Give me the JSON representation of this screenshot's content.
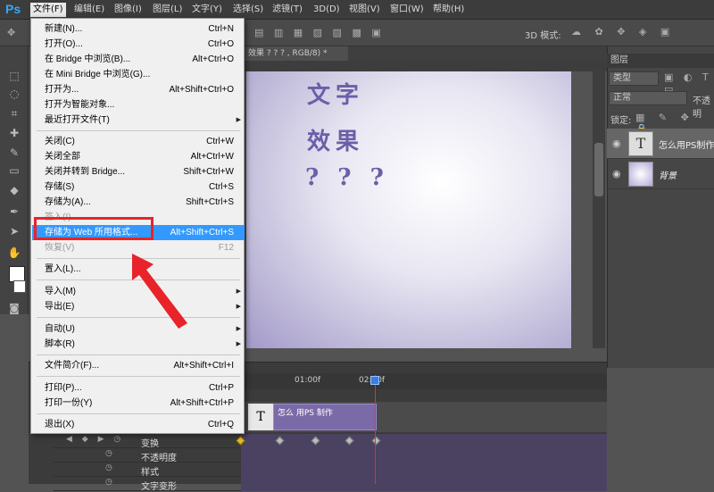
{
  "app": {
    "logo": "Ps",
    "brand_color": "#31a8ff"
  },
  "menubar": {
    "items": [
      {
        "label": "文件(F)",
        "active": true
      },
      {
        "label": "编辑(E)"
      },
      {
        "label": "图像(I)"
      },
      {
        "label": "图层(L)"
      },
      {
        "label": "文字(Y)"
      },
      {
        "label": "选择(S)"
      },
      {
        "label": "滤镜(T)"
      },
      {
        "label": "3D(D)"
      },
      {
        "label": "视图(V)"
      },
      {
        "label": "窗口(W)"
      },
      {
        "label": "帮助(H)"
      }
    ]
  },
  "options_bar": {
    "mode_label": "3D 模式:"
  },
  "document": {
    "tab_label": "效果 ? ? ? , RGB/8) *",
    "canvas_text": {
      "line1": "文字",
      "line2": "效果",
      "line3": "? ? ?"
    }
  },
  "file_menu": {
    "items": [
      {
        "label": "新建(N)...",
        "shortcut": "Ctrl+N"
      },
      {
        "label": "打开(O)...",
        "shortcut": "Ctrl+O"
      },
      {
        "label": "在 Bridge 中浏览(B)...",
        "shortcut": "Alt+Ctrl+O"
      },
      {
        "label": "在 Mini Bridge 中浏览(G)...",
        "shortcut": ""
      },
      {
        "label": "打开为...",
        "shortcut": "Alt+Shift+Ctrl+O"
      },
      {
        "label": "打开为智能对象...",
        "shortcut": ""
      },
      {
        "label": "最近打开文件(T)",
        "shortcut": "",
        "submenu": true
      },
      {
        "label": "关闭(C)",
        "shortcut": "Ctrl+W"
      },
      {
        "label": "关闭全部",
        "shortcut": "Alt+Ctrl+W"
      },
      {
        "label": "关闭并转到 Bridge...",
        "shortcut": "Shift+Ctrl+W"
      },
      {
        "label": "存储(S)",
        "shortcut": "Ctrl+S"
      },
      {
        "label": "存储为(A)...",
        "shortcut": "Shift+Ctrl+S"
      },
      {
        "label": "签入(I)...",
        "shortcut": "",
        "disabled": true
      },
      {
        "label": "存储为 Web 所用格式...",
        "shortcut": "Alt+Shift+Ctrl+S",
        "highlight": true
      },
      {
        "label": "恢复(V)",
        "shortcut": "F12",
        "disabled": true
      },
      {
        "label": "置入(L)...",
        "shortcut": ""
      },
      {
        "label": "导入(M)",
        "shortcut": "",
        "submenu": true
      },
      {
        "label": "导出(E)",
        "shortcut": "",
        "submenu": true
      },
      {
        "label": "自动(U)",
        "shortcut": "",
        "submenu": true
      },
      {
        "label": "脚本(R)",
        "shortcut": "",
        "submenu": true
      },
      {
        "label": "文件简介(F)...",
        "shortcut": "Alt+Shift+Ctrl+I"
      },
      {
        "label": "打印(P)...",
        "shortcut": "Ctrl+P"
      },
      {
        "label": "打印一份(Y)",
        "shortcut": "Alt+Shift+Ctrl+P"
      },
      {
        "label": "退出(X)",
        "shortcut": "Ctrl+Q"
      }
    ]
  },
  "layers_panel": {
    "tab_label": "图层",
    "filter_label": "类型",
    "blend_mode": "正常",
    "opacity_label": "不透明",
    "lock_label": "锁定:",
    "layers": [
      {
        "name": "怎么用PS制作",
        "type": "text",
        "selected": true
      },
      {
        "name": "背景",
        "type": "image"
      }
    ]
  },
  "timeline": {
    "time_labels": [
      "01:00f",
      "02:00f"
    ],
    "clip_label": "怎么 用PS 制作",
    "rows": [
      {
        "label": "变换"
      },
      {
        "label": "不透明度"
      },
      {
        "label": "样式"
      },
      {
        "label": "文字变形"
      }
    ]
  },
  "annotation": {
    "box_color": "#e8232a"
  }
}
